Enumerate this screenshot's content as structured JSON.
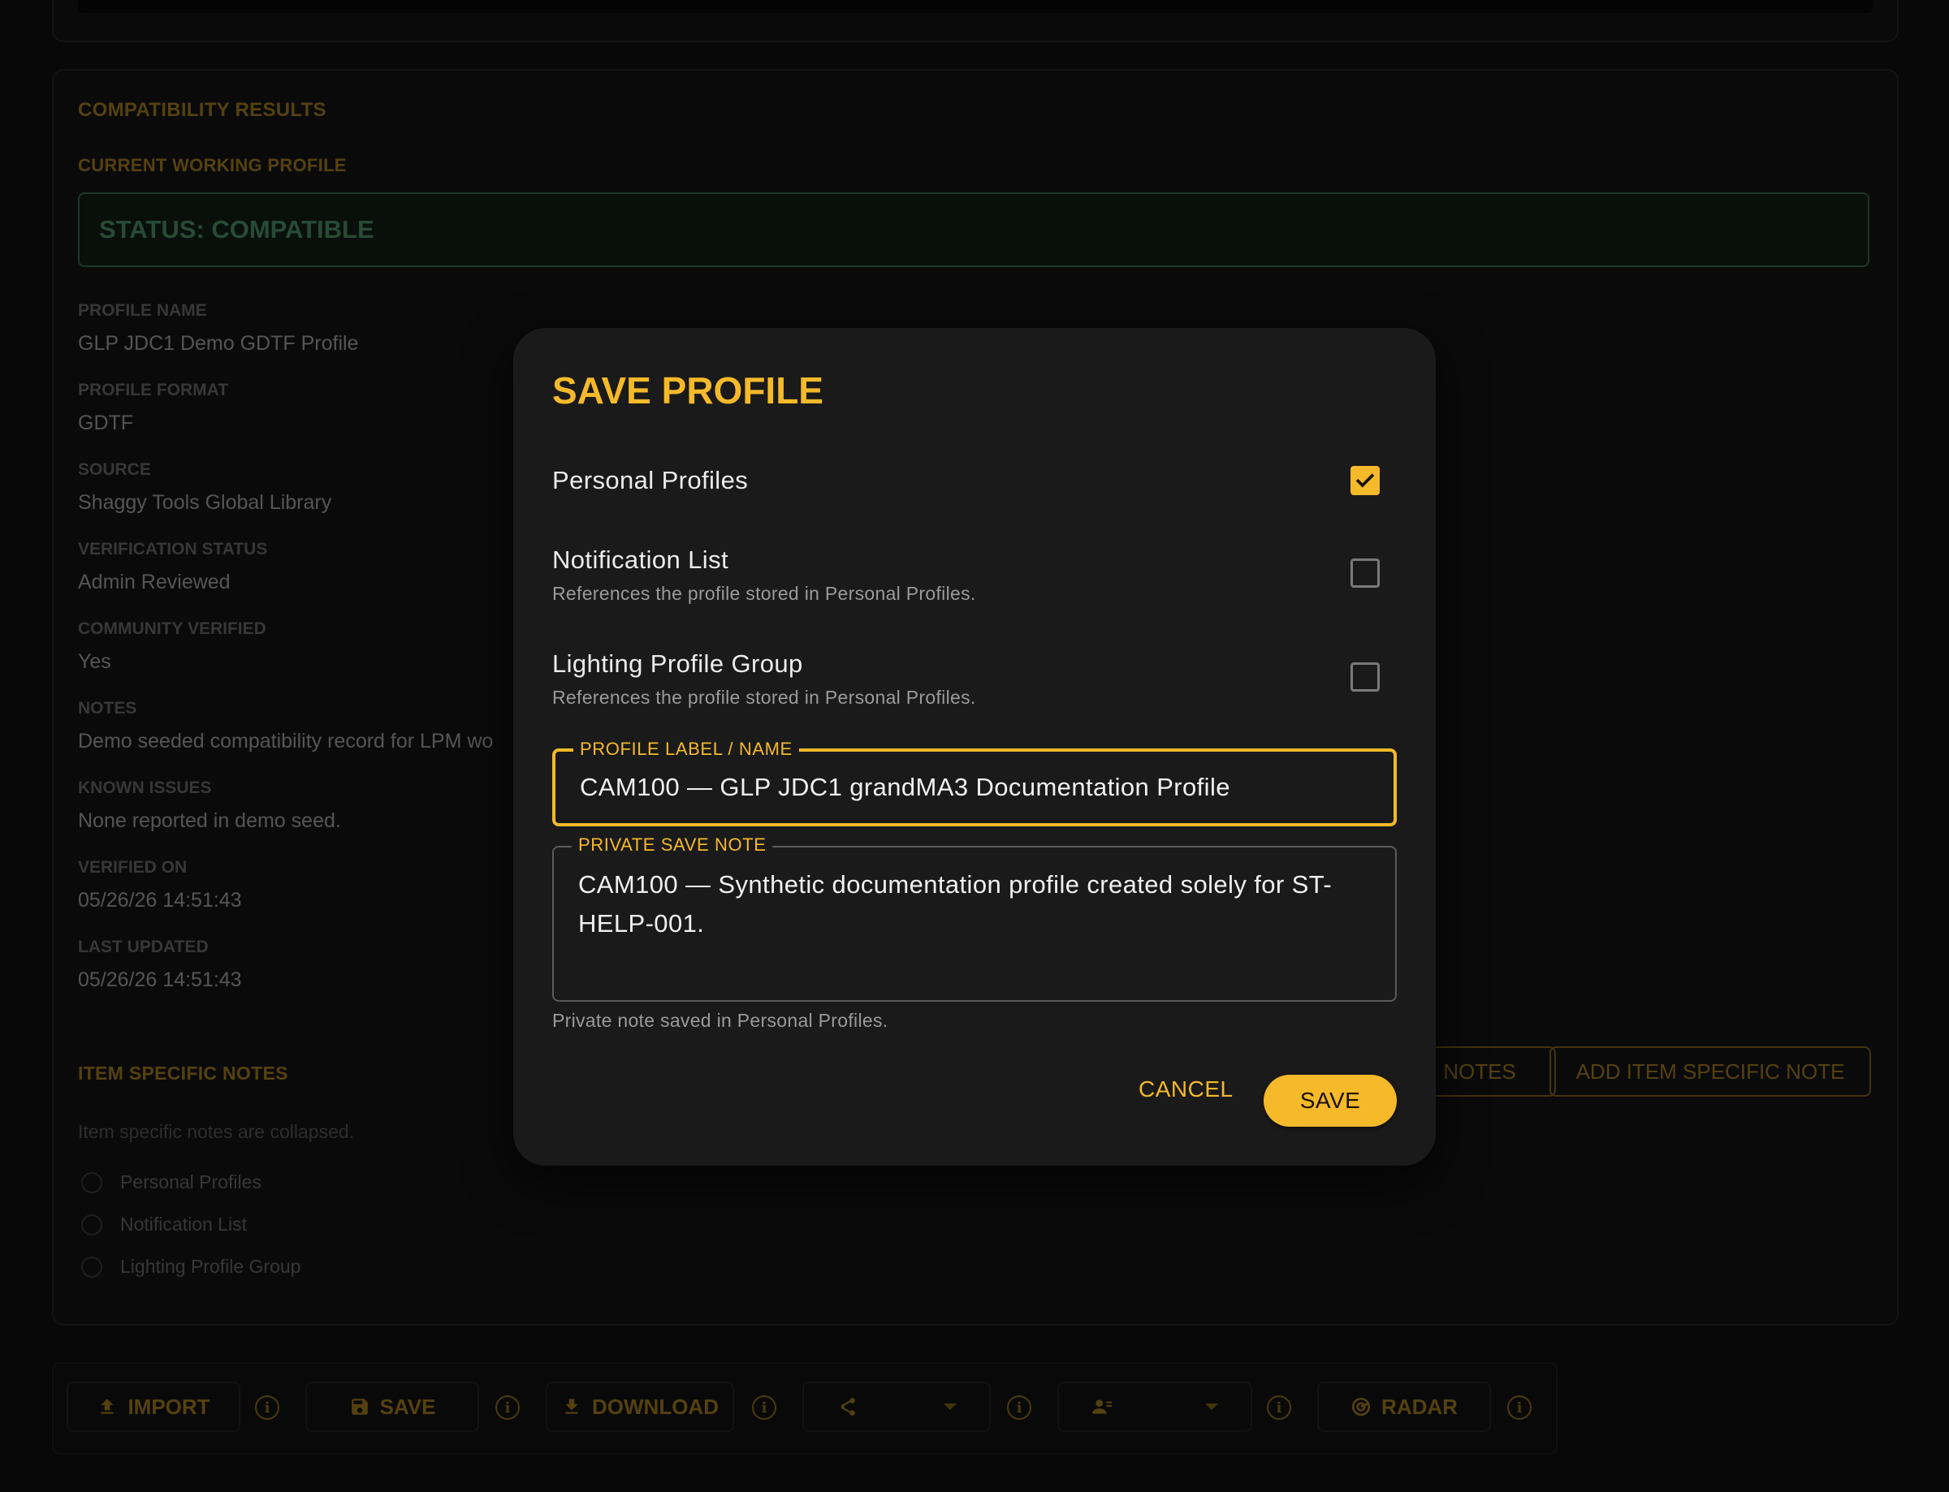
{
  "results": {
    "title": "COMPATIBILITY RESULTS",
    "subtitle": "CURRENT WORKING PROFILE",
    "status": "STATUS: COMPATIBLE",
    "fields": [
      {
        "key": "PROFILE NAME",
        "value": "GLP JDC1 Demo GDTF Profile"
      },
      {
        "key": "PROFILE FORMAT",
        "value": "GDTF"
      },
      {
        "key": "SOURCE",
        "value": "Shaggy Tools Global Library"
      },
      {
        "key": "VERIFICATION STATUS",
        "value": "Admin Reviewed"
      },
      {
        "key": "COMMUNITY VERIFIED",
        "value": "Yes"
      },
      {
        "key": "NOTES",
        "value": "Demo seeded compatibility record for LPM wo"
      },
      {
        "key": "KNOWN ISSUES",
        "value": "None reported in demo seed."
      },
      {
        "key": "VERIFIED ON",
        "value": "05/26/26 14:51:43"
      },
      {
        "key": "LAST UPDATED",
        "value": "05/26/26 14:51:43"
      }
    ],
    "item_notes": {
      "title": "ITEM SPECIFIC NOTES",
      "collapsed_text": "Item specific notes are collapsed.",
      "options": [
        "Personal Profiles",
        "Notification List",
        "Lighting Profile Group"
      ],
      "notes_button": "NOTES",
      "add_button": "ADD ITEM SPECIFIC NOTE"
    }
  },
  "toolbar": {
    "import": "IMPORT",
    "save": "SAVE",
    "download": "DOWNLOAD",
    "radar": "RADAR",
    "info_glyph": "i"
  },
  "dialog": {
    "title": "SAVE PROFILE",
    "options": [
      {
        "label": "Personal Profiles",
        "help": "",
        "checked": true
      },
      {
        "label": "Notification List",
        "help": "References the profile stored in Personal Profiles.",
        "checked": false
      },
      {
        "label": "Lighting Profile Group",
        "help": "References the profile stored in Personal Profiles.",
        "checked": false
      }
    ],
    "label_field": {
      "legend": "PROFILE LABEL / NAME",
      "value": "CAM100 — GLP JDC1 grandMA3 Documentation Profile"
    },
    "note_field": {
      "legend": "PRIVATE SAVE NOTE",
      "value": "CAM100 — Synthetic documentation profile created solely for ST-HELP-001."
    },
    "helper": "Private note saved in Personal Profiles.",
    "cancel": "CANCEL",
    "save": "SAVE"
  },
  "colors": {
    "accent": "#f5b92a",
    "status_green": "#3f7a56",
    "background": "#0d0d0d",
    "dialog": "#1a1a1a"
  }
}
